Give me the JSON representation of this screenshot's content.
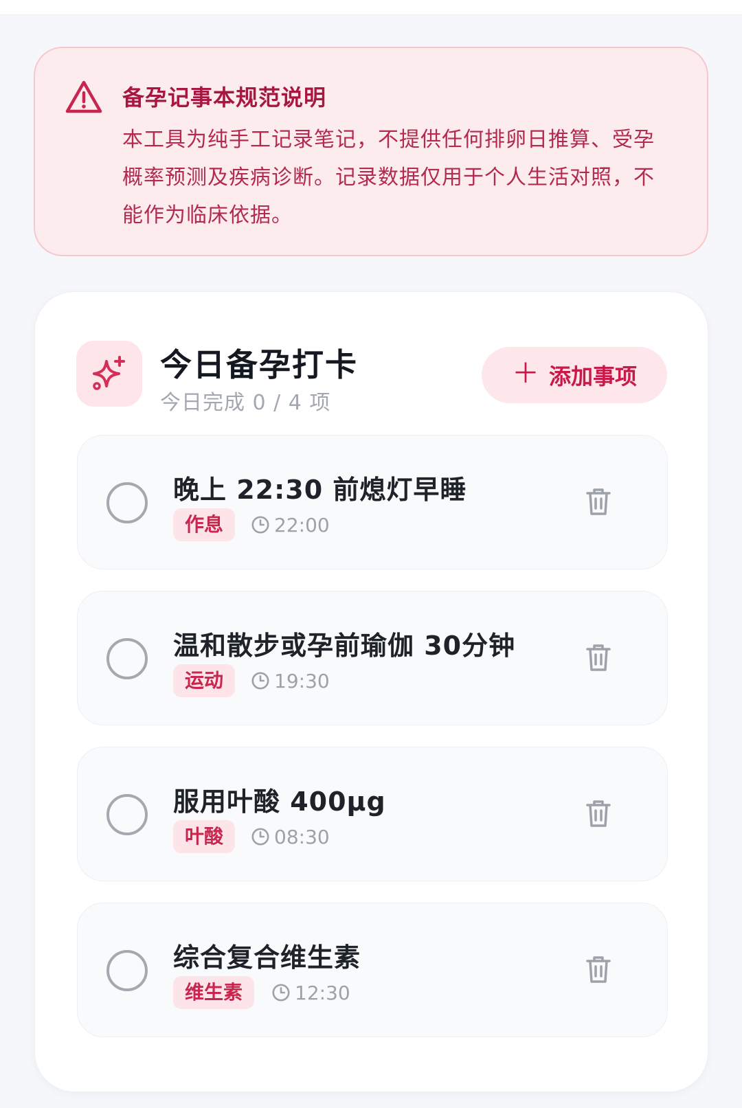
{
  "notice": {
    "title": "备孕记事本规范说明",
    "body": "本工具为纯手工记录笔记，不提供任何排卵日推算、受孕概率预测及疾病诊断。记录数据仅用于个人生活对照，不能作为临床依据。",
    "icon": "warning-triangle-icon"
  },
  "checkin": {
    "icon": "sparkles-icon",
    "title": "今日备孕打卡",
    "progress": "今日完成 0 / 4 项",
    "add_label": "添加事项"
  },
  "tasks": [
    {
      "name": "晚上 22:30 前熄灯早睡",
      "tag": "作息",
      "time": "22:00",
      "done": false
    },
    {
      "name": "温和散步或孕前瑜伽 30分钟",
      "tag": "运动",
      "time": "19:30",
      "done": false
    },
    {
      "name": "服用叶酸 400μg",
      "tag": "叶酸",
      "time": "08:30",
      "done": false
    },
    {
      "name": "综合复合维生素",
      "tag": "维生素",
      "time": "12:30",
      "done": false
    }
  ],
  "colors": {
    "accent": "#c81a48",
    "notice_bg": "#fdecee",
    "tag_bg": "#fde4e8"
  }
}
